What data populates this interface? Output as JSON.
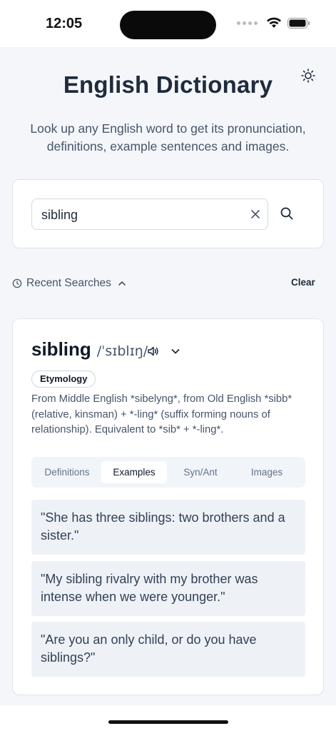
{
  "status": {
    "time": "12:05"
  },
  "header": {
    "title": "English Dictionary",
    "subtitle": "Look up any English word to get its pronunciation, definitions, example sentences and images."
  },
  "search": {
    "value": "sibling",
    "placeholder": ""
  },
  "recent": {
    "label": "Recent Searches",
    "clear_label": "Clear"
  },
  "word": {
    "headword": "sibling",
    "phonetic": "/ˈsɪblɪŋ/",
    "etymology_label": "Etymology",
    "etymology_text": "From Middle English *sibelyng*, from Old English *sibb* (relative, kinsman) + *-ling* (suffix forming nouns of relationship). Equivalent to *sib* + *-ling*."
  },
  "tabs": [
    {
      "label": "Definitions"
    },
    {
      "label": "Examples"
    },
    {
      "label": "Syn/Ant"
    },
    {
      "label": "Images"
    }
  ],
  "active_tab": "Examples",
  "examples": [
    "\"She has three siblings: two brothers and a sister.\"",
    "\"My sibling rivalry with my brother was intense when we were younger.\"",
    "\"Are you an only child, or do you have siblings?\""
  ],
  "icons": {
    "theme": "sun-icon",
    "clear": "close-icon",
    "search": "search-icon",
    "recent": "clock-icon",
    "recent_toggle": "chevron-up-icon",
    "audio": "speaker-icon",
    "expand": "chevron-down-icon"
  }
}
